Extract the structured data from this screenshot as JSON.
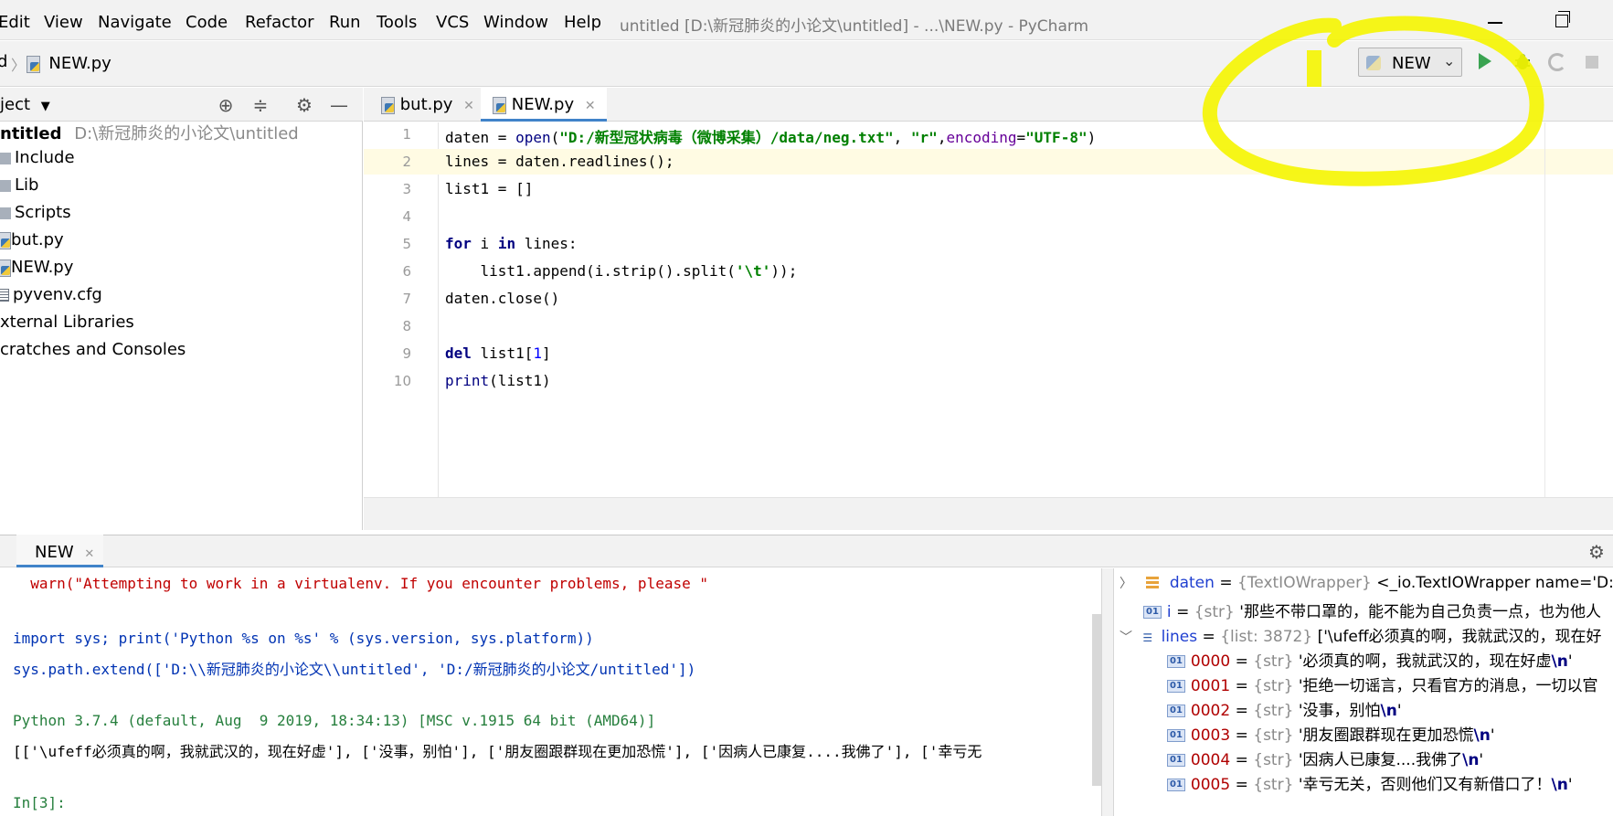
{
  "menu": {
    "items": [
      "Edit",
      "View",
      "Navigate",
      "Code",
      "Refactor",
      "Run",
      "Tools",
      "VCS",
      "Window",
      "Help"
    ],
    "window_title": "untitled [D:\\新冠肺炎的小论文\\untitled] - ...\\NEW.py - PyCharm"
  },
  "navbar": {
    "breadcrumb_fragment": "d",
    "breadcrumb_file": "NEW.py"
  },
  "run_toolbar": {
    "config_name": "NEW"
  },
  "project": {
    "header": "ject",
    "root_name": "ntitled",
    "root_path": "D:\\新冠肺炎的小论文\\untitled",
    "items": [
      "Include",
      "Lib",
      "Scripts",
      "but.py",
      "NEW.py",
      "pyvenv.cfg"
    ],
    "external": "xternal Libraries",
    "scratches": "cratches and Consoles"
  },
  "editor": {
    "tabs": [
      "but.py",
      "NEW.py"
    ],
    "line_numbers": [
      "1",
      "2",
      "3",
      "4",
      "5",
      "6",
      "7",
      "8",
      "9",
      "10"
    ],
    "code": {
      "l1a": "daten = ",
      "l1b": "open",
      "l1c": "(",
      "l1d": "\"D:/新型冠状病毒（微博采集）/data/neg.txt\"",
      "l1e": ", ",
      "l1f": "\"r\"",
      "l1g": ",",
      "l1h": "encoding",
      "l1i": "=",
      "l1j": "\"UTF-8\"",
      "l1k": ")",
      "l2": "lines = daten.readlines();",
      "l3": "list1 = []",
      "l5a": "for",
      "l5b": " i ",
      "l5c": "in",
      "l5d": " lines:",
      "l6a": "    list1.append(i.strip().split(",
      "l6b": "'\\t'",
      "l6c": "));",
      "l7": "daten.close()",
      "l9a": "del",
      "l9b": " list1[",
      "l9c": "1",
      "l9d": "]",
      "l10a": "print",
      "l10b": "(list1)"
    }
  },
  "run_panel": {
    "tab_label": "NEW",
    "console": {
      "c1": "  warn(\"Attempting to work in a virtualenv. If you encounter problems, please \"",
      "c2": "import sys; print('Python %s on %s' % (sys.version, sys.platform))",
      "c3": "sys.path.extend(['D:\\\\新冠肺炎的小论文\\\\untitled', 'D:/新冠肺炎的小论文/untitled'])",
      "c4": "Python 3.7.4 (default, Aug  9 2019, 18:34:13) [MSC v.1915 64 bit (AMD64)]",
      "c5": "[['\\ufeff必须真的啊，我就武汉的，现在好虚'], ['没事，别怕'], ['朋友圈跟群现在更加恐慌'], ['因病人已康复....我佛了'], ['幸亏无",
      "c6": "In[3]:"
    },
    "variables": [
      {
        "name": "daten",
        "type": "{TextIOWrapper}",
        "value": "<_io.TextIOWrapper name='D:/"
      },
      {
        "name": "i",
        "type": "{str}",
        "value": "'那些不带口罩的，能不能为自己负责一点，也为他人"
      },
      {
        "name": "lines",
        "type": "{list: 3872}",
        "value": "['\\ufeff必须真的啊，我就武汉的，现在好"
      },
      {
        "name": "0000",
        "type": "{str}",
        "value": "'必须真的啊，我就武汉的，现在好虚",
        "esc": "\\n",
        "end": "'"
      },
      {
        "name": "0001",
        "type": "{str}",
        "value": "'拒绝一切谣言，只看官方的消息，一切以官"
      },
      {
        "name": "0002",
        "type": "{str}",
        "value": "'没事，别怕",
        "esc": "\\n",
        "end": "'"
      },
      {
        "name": "0003",
        "type": "{str}",
        "value": "'朋友圈跟群现在更加恐慌",
        "esc": "\\n",
        "end": "'"
      },
      {
        "name": "0004",
        "type": "{str}",
        "value": "'因病人已康复....我佛了",
        "esc": "\\n",
        "end": "'"
      },
      {
        "name": "0005",
        "type": "{str}",
        "value": "'幸亏无关，否则他们又有新借口了！",
        "esc": "\\n",
        "end": "'"
      }
    ],
    "eq": "="
  },
  "colors": {
    "annotation": "#f5f500",
    "accent": "#4083c9",
    "run_green": "#3aa351"
  }
}
